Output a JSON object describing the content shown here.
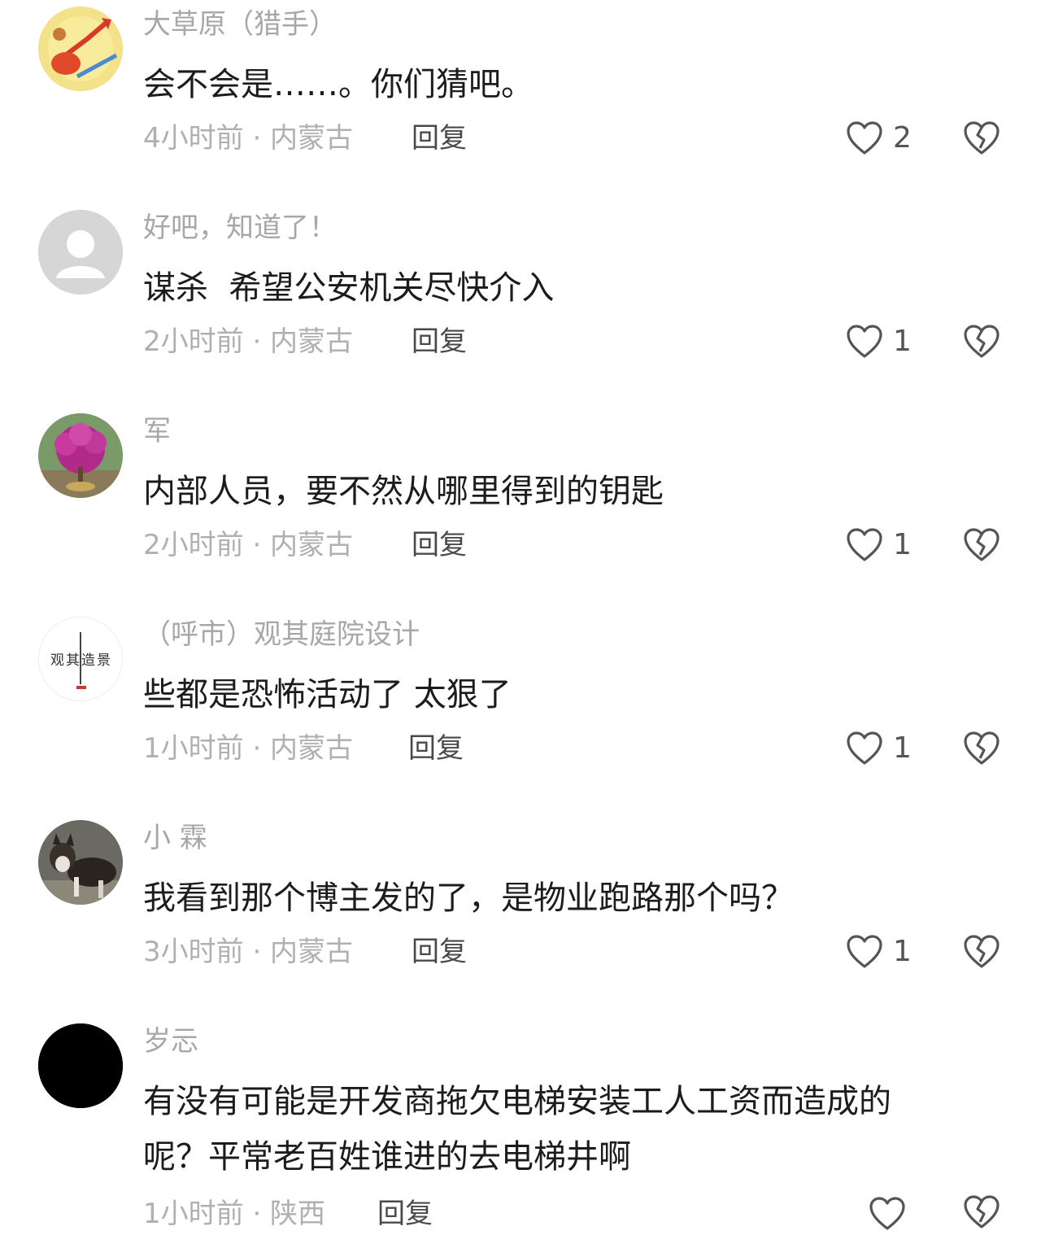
{
  "comments": [
    {
      "username": "大草原（猎手）",
      "content": "会不会是……。你们猜吧。",
      "meta": "4小时前 · 内蒙古",
      "reply": "回复",
      "likes": "2",
      "avatar": "avatar-cartoon-icon"
    },
    {
      "username": "好吧，知道了！",
      "content": "谋杀  希望公安机关尽快介入",
      "meta": "2小时前 · 内蒙古",
      "reply": "回复",
      "likes": "1",
      "avatar": "avatar-default-icon"
    },
    {
      "username": "军",
      "content": "内部人员，要不然从哪里得到的钥匙",
      "meta": "2小时前 · 内蒙古",
      "reply": "回复",
      "likes": "1",
      "avatar": "avatar-flower-icon"
    },
    {
      "username": "（呼市）观其庭院设计",
      "content": "些都是恐怖活动了 太狠了",
      "meta": "1小时前 · 内蒙古",
      "reply": "回复",
      "likes": "1",
      "avatar": "avatar-logo-icon",
      "avatar_text": "观其造景"
    },
    {
      "username": "小 霖",
      "content": "我看到那个博主发的了，是物业跑路那个吗？",
      "meta": "3小时前 · 内蒙古",
      "reply": "回复",
      "likes": "1",
      "avatar": "avatar-dog-icon"
    },
    {
      "username": "岁忈",
      "content_lines": [
        "有没有可能是开发商拖欠电梯安装工人工资而造成的",
        "呢？平常老百姓谁进的去电梯井啊"
      ],
      "meta": "1小时前 · 陕西",
      "reply": "回复",
      "likes": "",
      "avatar": "avatar-black-icon"
    }
  ],
  "colors": {
    "username": "#a7a7a7",
    "content": "#1c1c1c",
    "meta": "#b0b0b0",
    "icon_stroke": "#555555"
  }
}
